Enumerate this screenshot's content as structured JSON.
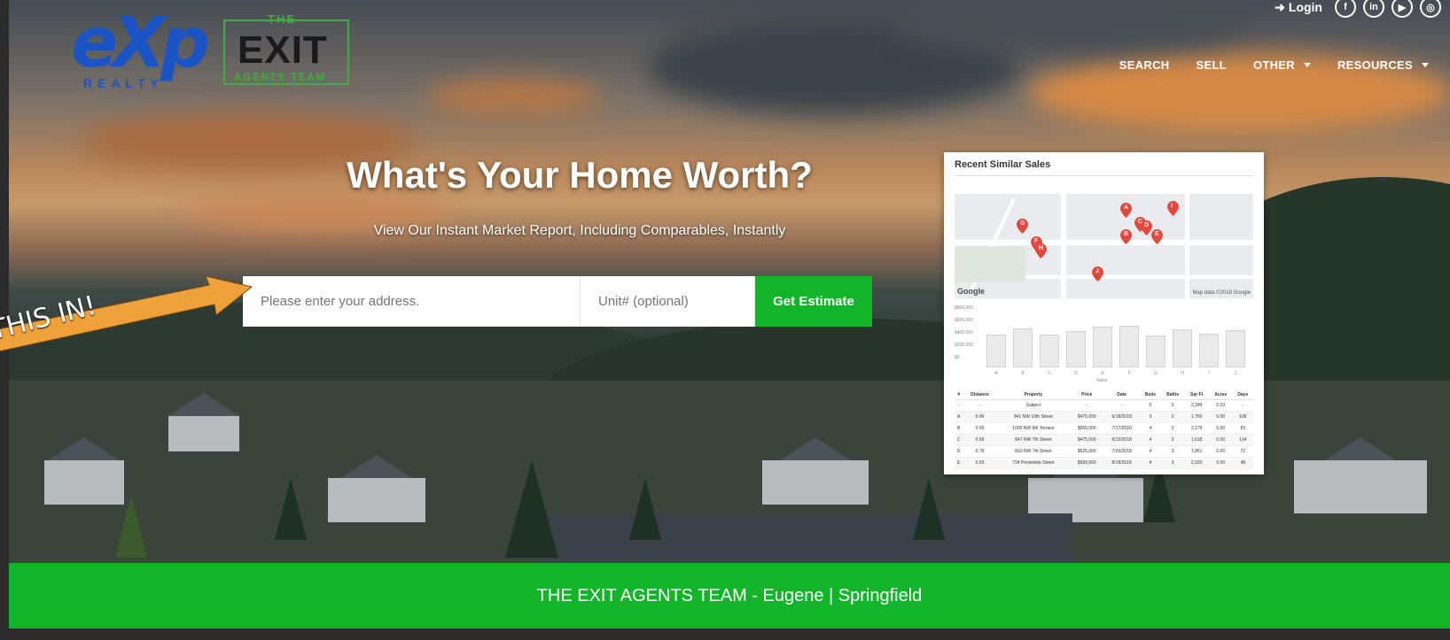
{
  "brand": {
    "exp_logo_text": "eXp",
    "exp_logo_sub": "REALTY",
    "exit_logo_top": "THE",
    "exit_logo_main": "EXIT",
    "exit_logo_sub": "AGENTS TEAM",
    "accent_green": "#12b52a",
    "exp_blue": "#1b54c4"
  },
  "top": {
    "login_label": "Login",
    "social_icons": [
      "facebook-icon",
      "linkedin-icon",
      "youtube-icon",
      "instagram-icon"
    ]
  },
  "nav": {
    "items": [
      {
        "label": "SEARCH",
        "has_dropdown": false
      },
      {
        "label": "SELL",
        "has_dropdown": false
      },
      {
        "label": "OTHER",
        "has_dropdown": true
      },
      {
        "label": "RESOURCES",
        "has_dropdown": true
      }
    ]
  },
  "hero": {
    "headline": "What's Your Home Worth?",
    "subline": "View Our Instant Market Report, Including Comparables, Instantly"
  },
  "search": {
    "address_placeholder": "Please enter your address.",
    "unit_placeholder": "Unit# (optional)",
    "button_label": "Get Estimate"
  },
  "annotation": {
    "text": "THIS IN!"
  },
  "report": {
    "title": "Recent Similar Sales",
    "map_brand": "Google",
    "map_credit": "Map data ©2018 Google",
    "pins": [
      "A",
      "B",
      "C",
      "D",
      "E",
      "F",
      "G",
      "H",
      "I",
      "J"
    ],
    "y_ticks": [
      "$800,000",
      "$600,000",
      "$400,000",
      "$200,000",
      "$0"
    ],
    "bar_categories": [
      "A",
      "B",
      "C",
      "D",
      "E",
      "F",
      "G",
      "H",
      "I",
      "J"
    ],
    "bar_values": [
      0.62,
      0.74,
      0.62,
      0.69,
      0.76,
      0.78,
      0.6,
      0.72,
      0.64,
      0.7
    ],
    "bar_axis_label": "Value",
    "table_headers": [
      "#",
      "Distance",
      "Property",
      "Price",
      "Date",
      "Beds",
      "Baths",
      "Sqr Ft",
      "Acres",
      "Days"
    ],
    "table_rows": [
      [
        "-",
        "-",
        "Subject",
        "-",
        "-",
        "0",
        "3",
        "2,249",
        "0.23",
        "-"
      ],
      [
        "A",
        "0.46",
        "941 NW 10th Street",
        "$475,000",
        "6/18/2018",
        "3",
        "2",
        "1,760",
        "0.00",
        "109"
      ],
      [
        "B",
        "0.65",
        "1000 NW 6th Terrace",
        "$565,000",
        "7/17/2018",
        "4",
        "2",
        "2,179",
        "0.00",
        "83"
      ],
      [
        "C",
        "0.69",
        "847 NW 7th Street",
        "$475,000",
        "6/13/2018",
        "4",
        "2",
        "1,618",
        "0.00",
        "114"
      ],
      [
        "D",
        "0.76",
        "810 NW 7th Street",
        "$525,000",
        "7/25/2018",
        "4",
        "3",
        "1,851",
        "0.00",
        "72"
      ],
      [
        "E",
        "0.93",
        "724 Periwinkle Street",
        "$599,900",
        "8/18/2018",
        "4",
        "3",
        "2,020",
        "0.00",
        "48"
      ]
    ]
  },
  "footer": {
    "text": "THE EXIT AGENTS TEAM - Eugene | Springfield"
  }
}
